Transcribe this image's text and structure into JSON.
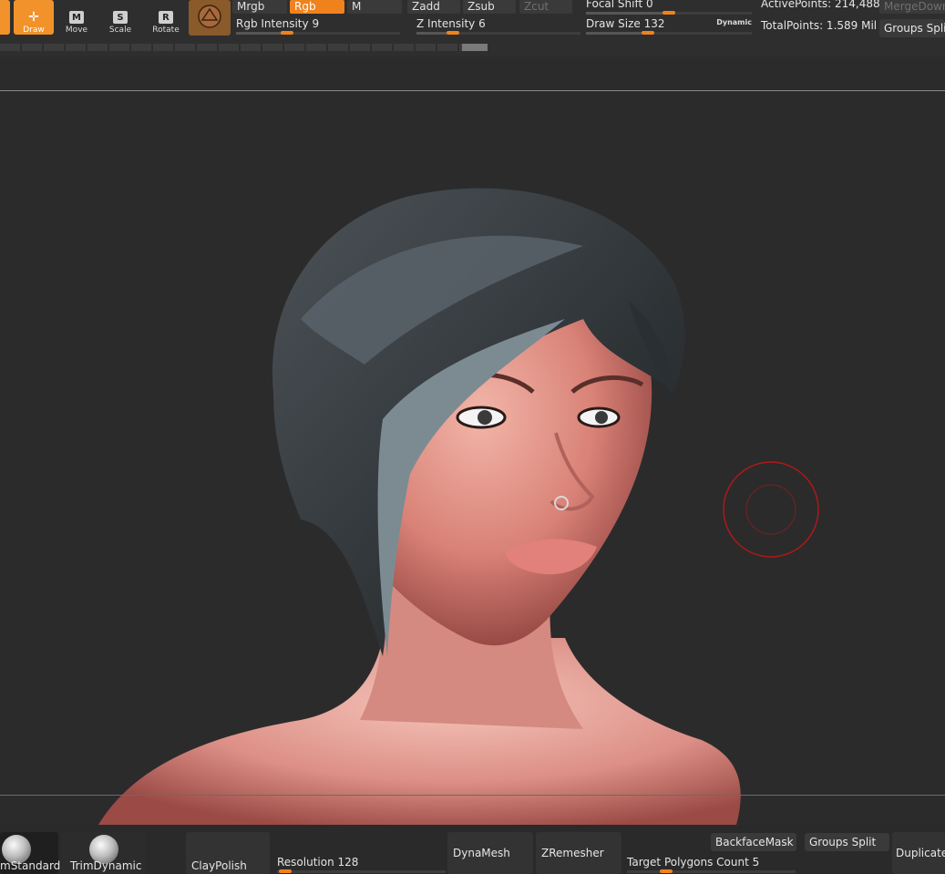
{
  "tools": {
    "draw": "Draw",
    "move": "Move",
    "scale": "Scale",
    "rotate": "Rotate"
  },
  "color_modes": {
    "mrgb": "Mrgb",
    "rgb": "Rgb",
    "m": "M"
  },
  "z_modes": {
    "zadd": "Zadd",
    "zsub": "Zsub",
    "zcut": "Zcut"
  },
  "rgb_intensity": {
    "label": "Rgb Intensity",
    "value": "9"
  },
  "z_intensity": {
    "label": "Z Intensity",
    "value": "6"
  },
  "focal_shift": {
    "label": "Focal Shift",
    "value": "0"
  },
  "draw_size": {
    "label": "Draw Size",
    "value": "132",
    "dynamic_label": "Dynamic"
  },
  "stats": {
    "active_points": "ActivePoints: 214,488",
    "total_points": "TotalPoints: 1.589 Mil"
  },
  "merge_down": "MergeDown",
  "groups_split_top": "Groups Split",
  "brushes": [
    {
      "label": "mStandard"
    },
    {
      "label": "TrimDynamic"
    }
  ],
  "clay_polish": "ClayPolish",
  "resolution": {
    "label": "Resolution",
    "value": "128"
  },
  "dynamesh": "DynaMesh",
  "zremesher": "ZRemesher",
  "target_polygons": {
    "label": "Target Polygons Count",
    "value": "5"
  },
  "backface_mask": "BackfaceMask",
  "groups_split_bottom": "Groups Split",
  "duplicate": "Duplicate",
  "colors": {
    "accent": "#f0821e",
    "background": "#2b2b2b",
    "cursor_ring": "#b01818"
  }
}
